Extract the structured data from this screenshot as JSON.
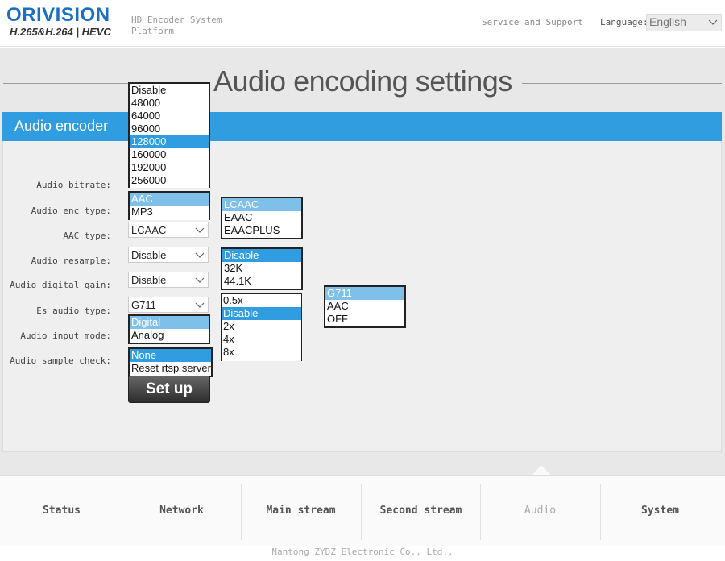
{
  "header": {
    "logo_text": "ORIVISION",
    "logo_subtext": "H.265&H.264 | HEVC",
    "system_title": "HD Encoder System Platform",
    "service_link": "Service and Support",
    "language_label": "Language:",
    "language_value": "English"
  },
  "page_title": "Audio encoding settings",
  "panel_title": "Audio encoder",
  "labels": {
    "bitrate": "Audio bitrate:",
    "enc_type": "Audio enc type:",
    "aac_type": "AAC type:",
    "resample": "Audio resample:",
    "digital_gain": "Audio digital gain:",
    "es_audio_type": "Es audio type:",
    "input_mode": "Audio input mode:",
    "sample_check": "Audio sample check:"
  },
  "bitrate_options": [
    "Disable",
    "48000",
    "64000",
    "96000",
    "128000",
    "160000",
    "192000",
    "256000"
  ],
  "enc_type_options": [
    "AAC",
    "MP3"
  ],
  "aac_type_options": [
    "LCAAC",
    "EAAC",
    "EAACPLUS"
  ],
  "resample_options": [
    "Disable",
    "32K",
    "44.1K"
  ],
  "digital_gain_options": [
    "0.5x",
    "Disable",
    "2x",
    "4x",
    "8x"
  ],
  "es_audio_options": [
    "G711",
    "AAC",
    "OFF"
  ],
  "input_mode_options": [
    "Digital",
    "Analog"
  ],
  "sample_check_options": [
    "None",
    "Reset rtsp server"
  ],
  "combos": {
    "aac_type": "LCAAC",
    "resample": "Disable",
    "digital_gain": "Disable",
    "es_audio_type": "G711"
  },
  "setup_button": "Set up",
  "nav": {
    "status": "Status",
    "network": "Network",
    "main_stream": "Main stream",
    "second_stream": "Second stream",
    "audio": "Audio",
    "system": "System"
  },
  "footer": "Nantong ZYDZ Electronic Co., Ltd.,",
  "colors": {
    "accent": "#2f9de0",
    "logo": "#1a6fc0"
  }
}
